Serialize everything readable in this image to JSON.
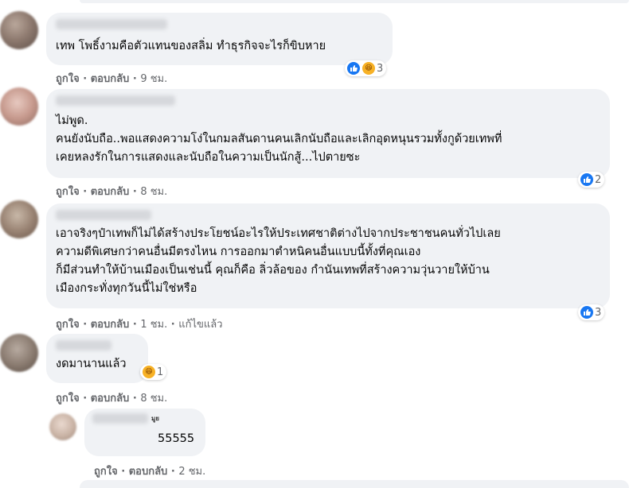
{
  "comments": [
    {
      "text": "เทพ โพธิ์งามคือตัวแทนของสลิ่ม ทำธุรกิจจะไรก็ขิบหาย",
      "like": "ถูกใจ",
      "reply": "ตอบกลับ",
      "time": "9 ชม.",
      "reaction_count": "3",
      "reactions": [
        "like-icon",
        "haha-icon"
      ]
    },
    {
      "text": "ไม่พูด.\nคนยังนับถือ..พอแสดงความโง่ในกมลสันดานคนเลิกนับถือและเลิกอุดหนุนรวมทั้งกูด้วยเทพที่\nเคยหลงรักในการแสดงและนับถือในความเป็นนักสู้...ไปตายซะ",
      "like": "ถูกใจ",
      "reply": "ตอบกลับ",
      "time": "8 ชม.",
      "reaction_count": "2",
      "reactions": [
        "like-icon"
      ]
    },
    {
      "text": "เอาจริงๆป๋าเทพก็ไม่ได้สร้างประโยชน์อะไรให้ประเทศชาติต่างไปจากประชาชนคนทั่วไปเลย\nความดีพิเศษกว่าคนอื่นมีตรงไหน การออกมาตำหนิคนอื่นแบบนี้ทั้งที่คุณเอง\nก็มีส่วนทำให้บ้านเมืองเป็นเช่นนี้ คุณก็คือ ลิ่วล้อของ กำนันเทพที่สร้างความวุ่นวายให้บ้าน\nเมืองกระทั่งทุกวันนี้ไม่ใช่หรือ",
      "like": "ถูกใจ",
      "reply": "ตอบกลับ",
      "time": "1 ชม.",
      "edited": "แก้ไขแล้ว",
      "reaction_count": "3",
      "reactions": [
        "like-icon"
      ]
    },
    {
      "text": "งดมานานแล้ว",
      "like": "ถูกใจ",
      "reply": "ตอบกลับ",
      "time": "8 ชม.",
      "reaction_count": "1",
      "reactions": [
        "haha-icon"
      ]
    },
    {
      "author_partial": "มูย",
      "text": "55555",
      "like": "ถูกใจ",
      "reply": "ตอบกลับ",
      "time": "2 ชม."
    }
  ],
  "separator": "·",
  "colors": {
    "bubble": "#f0f2f5",
    "like_blue": "#1877f2",
    "haha_yellow": "#f7b125",
    "meta": "#65676b"
  }
}
